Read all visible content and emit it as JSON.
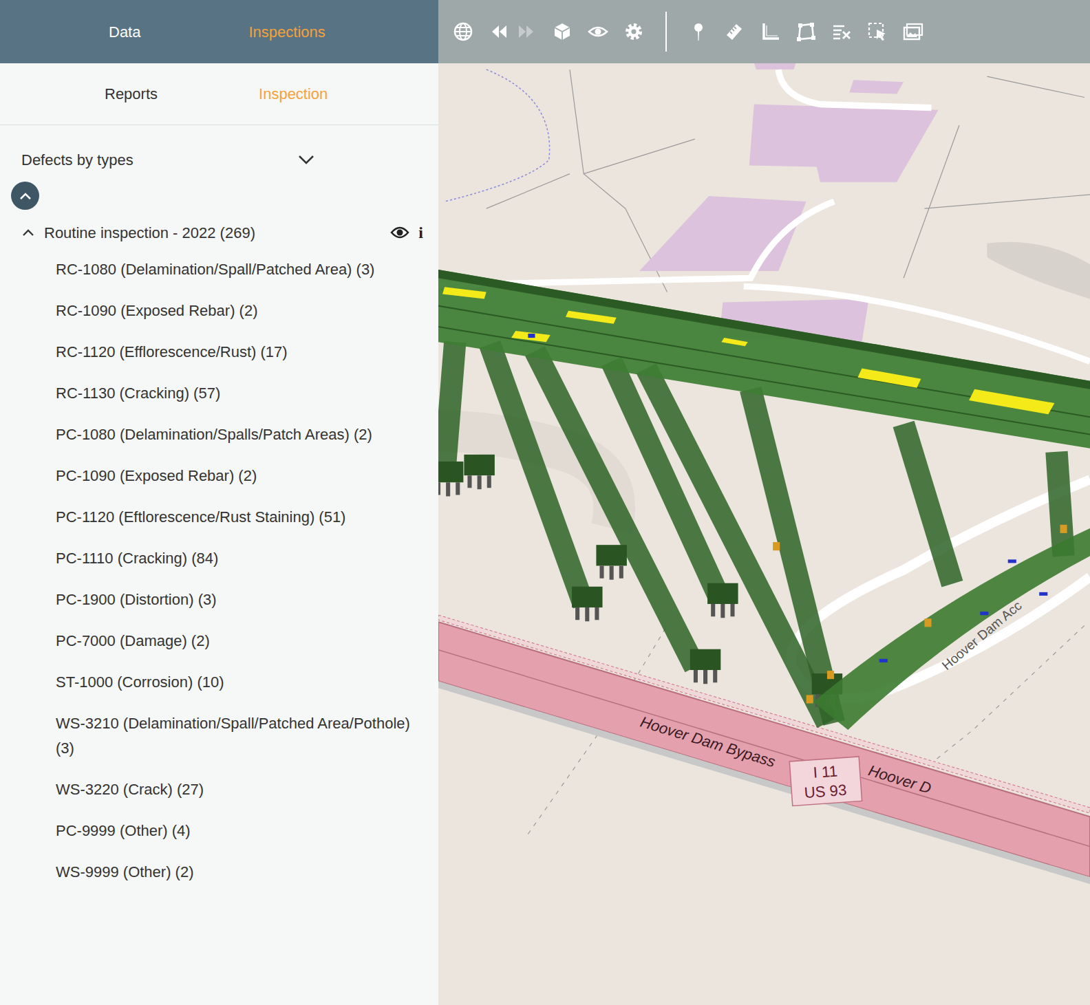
{
  "header_tabs": [
    {
      "label": "Data",
      "selected": false
    },
    {
      "label": "Inspections",
      "selected": true
    }
  ],
  "sub_tabs": [
    {
      "label": "Reports",
      "selected": false
    },
    {
      "label": "Inspection",
      "selected": true
    }
  ],
  "filter": {
    "label": "Defects by types"
  },
  "group": {
    "label": "Routine inspection - 2022 (269)",
    "expanded": true,
    "visible": true,
    "info": "i"
  },
  "items": [
    {
      "label": "RC-1080 (Delamination/Spall/Patched Area) (3)"
    },
    {
      "label": "RC-1090 (Exposed Rebar) (2)"
    },
    {
      "label": "RC-1120 (Efflorescence/Rust) (17)"
    },
    {
      "label": "RC-1130 (Cracking) (57)"
    },
    {
      "label": "PC-1080 (Delamination/Spalls/Patch Areas) (2)"
    },
    {
      "label": "PC-1090 (Exposed Rebar) (2)"
    },
    {
      "label": "PC-1120 (Eftlorescence/Rust Staining) (51)"
    },
    {
      "label": "PC-1110 (Cracking) (84)"
    },
    {
      "label": "PC-1900 (Distortion) (3)"
    },
    {
      "label": "PC-7000 (Damage) (2)"
    },
    {
      "label": "ST-1000 (Corrosion) (10)"
    },
    {
      "label": "WS-3210 (Delamination/Spall/Patched Area/Pothole) (3)"
    },
    {
      "label": "WS-3220 (Crack) (27)"
    },
    {
      "label": "PC-9999 (Other) (4)"
    },
    {
      "label": "WS-9999 (Other) (2)"
    }
  ],
  "toolbar": [
    {
      "kind": "globe",
      "disabled": false
    },
    {
      "kind": "back",
      "disabled": false
    },
    {
      "kind": "forward",
      "disabled": true
    },
    {
      "kind": "cube",
      "disabled": false
    },
    {
      "kind": "eye",
      "disabled": false
    },
    {
      "kind": "gear",
      "disabled": false
    },
    {
      "kind": "divider",
      "disabled": false
    },
    {
      "kind": "pin",
      "disabled": false
    },
    {
      "kind": "ruler",
      "disabled": false
    },
    {
      "kind": "angle",
      "disabled": false
    },
    {
      "kind": "area",
      "disabled": false
    },
    {
      "kind": "clear",
      "disabled": false
    },
    {
      "kind": "select",
      "disabled": false
    },
    {
      "kind": "screenshot",
      "disabled": false
    }
  ],
  "map": {
    "labels": [
      "Hoover Dam Bypass",
      "Hoover D",
      "I 11",
      "US 93",
      "Hoover Dam Acc"
    ]
  }
}
